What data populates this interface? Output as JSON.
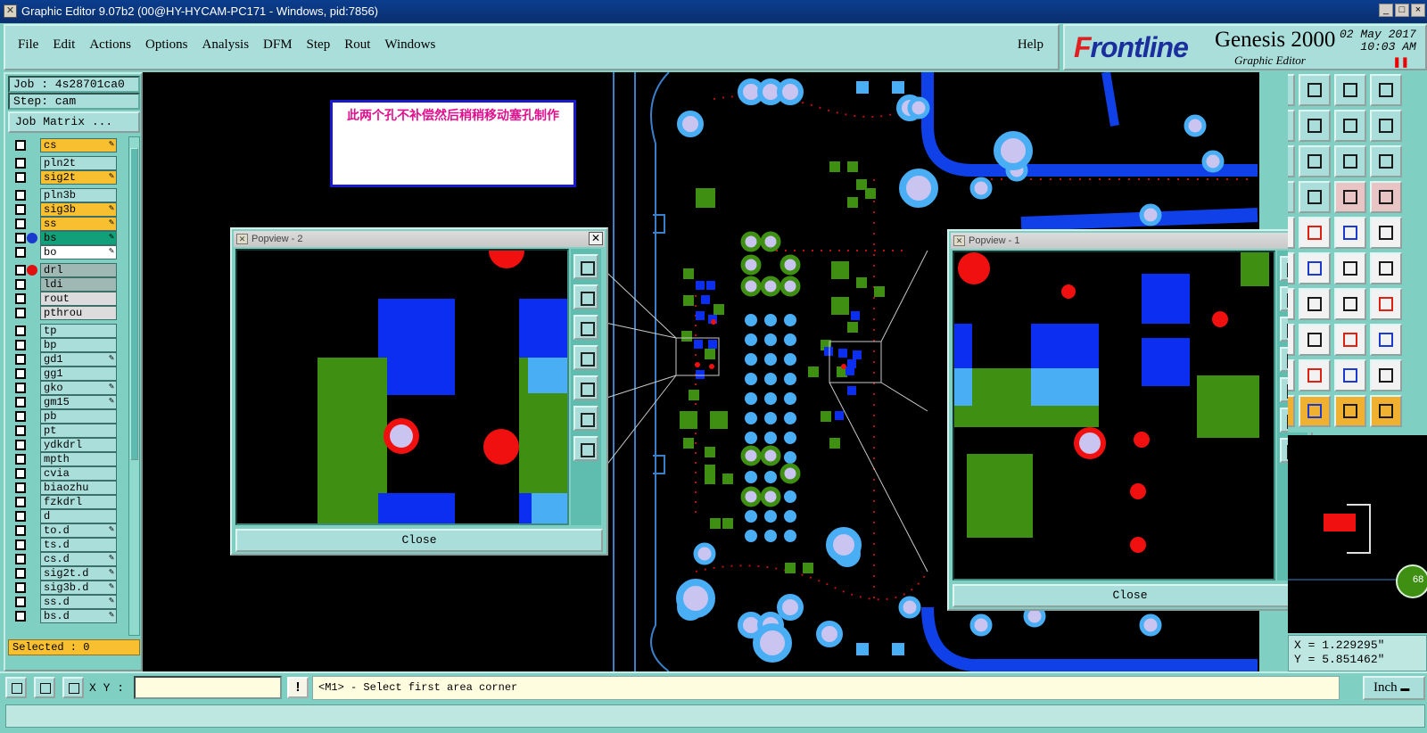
{
  "window": {
    "title": "Graphic Editor 9.07b2 (00@HY-HYCAM-PC171 - Windows, pid:7856)"
  },
  "menu": {
    "items": [
      "File",
      "Edit",
      "Actions",
      "Options",
      "Analysis",
      "DFM",
      "Step",
      "Rout",
      "Windows"
    ],
    "help": "Help"
  },
  "logo": {
    "brand_f": "F",
    "brand_rest": "rontline",
    "product": "Genesis 2000",
    "subtitle": "Graphic Editor",
    "date": "02 May 2017",
    "time": "10:03 AM"
  },
  "left_panel": {
    "job": "Job : 4s28701ca0",
    "step": "Step: cam",
    "job_matrix": "Job Matrix ...",
    "selected": "Selected : 0",
    "layers": [
      {
        "name": "cs",
        "color": "#f8c030",
        "pen": true,
        "dot": ""
      },
      {
        "name": "pln2t",
        "color": "#a9dedb",
        "pen": false,
        "dot": ""
      },
      {
        "name": "sig2t",
        "color": "#f8c030",
        "pen": true,
        "dot": ""
      },
      {
        "name": "pln3b",
        "color": "#a9dedb",
        "pen": false,
        "dot": ""
      },
      {
        "name": "sig3b",
        "color": "#f8c030",
        "pen": true,
        "dot": ""
      },
      {
        "name": "ss",
        "color": "#f8c030",
        "pen": true,
        "dot": ""
      },
      {
        "name": "bs",
        "color": "#12a07a",
        "pen": true,
        "dot": "#1a3ad0"
      },
      {
        "name": "bo",
        "color": "#ffffff",
        "pen": true,
        "dot": ""
      },
      {
        "name": "drl",
        "color": "#a0b8b4",
        "pen": false,
        "dot": "#e01010"
      },
      {
        "name": "ldi",
        "color": "#a0b8b4",
        "pen": false,
        "dot": ""
      },
      {
        "name": "rout",
        "color": "#dcdcdc",
        "pen": false,
        "dot": ""
      },
      {
        "name": "pthrou",
        "color": "#dcdcdc",
        "pen": false,
        "dot": ""
      },
      {
        "name": "tp",
        "color": "#a9dedb",
        "pen": false,
        "dot": ""
      },
      {
        "name": "bp",
        "color": "#a9dedb",
        "pen": false,
        "dot": ""
      },
      {
        "name": "gd1",
        "color": "#a9dedb",
        "pen": true,
        "dot": ""
      },
      {
        "name": "gg1",
        "color": "#a9dedb",
        "pen": false,
        "dot": ""
      },
      {
        "name": "gko",
        "color": "#a9dedb",
        "pen": true,
        "dot": ""
      },
      {
        "name": "gm15",
        "color": "#a9dedb",
        "pen": true,
        "dot": ""
      },
      {
        "name": "pb",
        "color": "#a9dedb",
        "pen": false,
        "dot": ""
      },
      {
        "name": "pt",
        "color": "#a9dedb",
        "pen": false,
        "dot": ""
      },
      {
        "name": "ydkdrl",
        "color": "#a9dedb",
        "pen": false,
        "dot": ""
      },
      {
        "name": "mpth",
        "color": "#a9dedb",
        "pen": false,
        "dot": ""
      },
      {
        "name": "cvia",
        "color": "#a9dedb",
        "pen": false,
        "dot": ""
      },
      {
        "name": "biaozhu",
        "color": "#a9dedb",
        "pen": false,
        "dot": ""
      },
      {
        "name": "fzkdrl",
        "color": "#a9dedb",
        "pen": false,
        "dot": ""
      },
      {
        "name": "d",
        "color": "#a9dedb",
        "pen": false,
        "dot": ""
      },
      {
        "name": "to.d",
        "color": "#a9dedb",
        "pen": true,
        "dot": ""
      },
      {
        "name": "ts.d",
        "color": "#a9dedb",
        "pen": false,
        "dot": ""
      },
      {
        "name": "cs.d",
        "color": "#a9dedb",
        "pen": true,
        "dot": ""
      },
      {
        "name": "sig2t.d",
        "color": "#a9dedb",
        "pen": true,
        "dot": ""
      },
      {
        "name": "sig3b.d",
        "color": "#a9dedb",
        "pen": true,
        "dot": ""
      },
      {
        "name": "ss.d",
        "color": "#a9dedb",
        "pen": true,
        "dot": ""
      },
      {
        "name": "bs.d",
        "color": "#a9dedb",
        "pen": true,
        "dot": ""
      }
    ]
  },
  "annotation": {
    "text": "此两个孔不补偿然后稍稍移动塞孔制作"
  },
  "popview2": {
    "title": "Popview - 2",
    "close": "Close",
    "close_glyph": "✕"
  },
  "popview1": {
    "title": "Popview - 1",
    "close": "Close",
    "close_glyph": "✕"
  },
  "coords": {
    "x": "X = 1.229295\"",
    "y": "Y = 5.851462\""
  },
  "minimap": {
    "badge": "68"
  },
  "bottom": {
    "xy_label": "X Y :",
    "warn": "!",
    "prompt": "<M1> - Select first area corner",
    "unit": "Inch"
  },
  "colors": {
    "panel": "#7fcfc2",
    "button": "#a9dedb",
    "highlight_layer": "#f8c030",
    "pad_green": "#3f8f12",
    "pad_blue": "#0b2ef0",
    "pad_lightblue": "#4aaef5",
    "drill_red": "#f01010",
    "via_lavender": "#c9c4f0"
  }
}
